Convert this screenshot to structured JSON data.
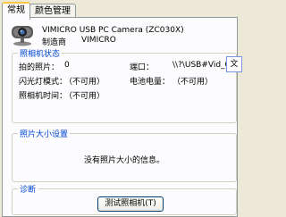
{
  "tabs": [
    {
      "label": "常规",
      "active": true
    },
    {
      "label": "颜色管理",
      "active": false
    }
  ],
  "device": {
    "name": "VIMICRO USB PC Camera (ZC030X)",
    "manufacturer_label": "制造商",
    "manufacturer": "VIMICRO"
  },
  "status_group": {
    "title": "照相机状态",
    "photos_taken_label": "拍的照片：",
    "photos_taken_value": "0",
    "port_label": "端口：",
    "port_value": "\\\\?\\USB#Vid_0",
    "flash_mode_label": "闪光灯模式：",
    "flash_mode_value": "（不可用）",
    "battery_label": "电池电量：",
    "battery_value": "（不可用）",
    "camera_time_label": "照相机时间：",
    "camera_time_value": "（不可用）"
  },
  "photo_size_group": {
    "title": "照片大小设置",
    "message": "没有照片大小的信息。"
  },
  "diagnostics_group": {
    "title": "诊断",
    "test_button_label": "测试照相机(T)"
  },
  "overlay_window": {
    "text": "文"
  },
  "colors": {
    "group_title": "#0046d5",
    "tab_highlight": "#ffc83c",
    "panel_background": "#fcfcfe",
    "window_background": "#ece9d8"
  },
  "icons": {
    "device_icon": "webcam-icon"
  }
}
